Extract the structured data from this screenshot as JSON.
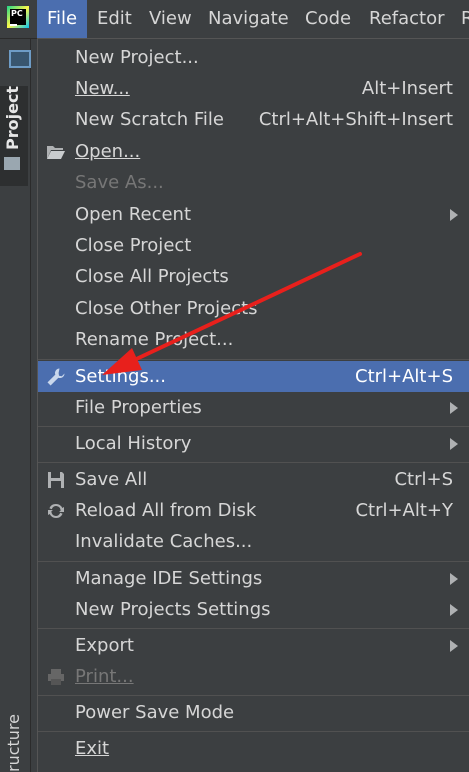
{
  "menubar": {
    "logo_text": "PC",
    "items": [
      "File",
      "Edit",
      "View",
      "Navigate",
      "Code",
      "Refactor",
      "R"
    ]
  },
  "sidebar": {
    "project_label": "Project",
    "structure_label": "ructure"
  },
  "file_menu": {
    "new_project": "New Project...",
    "new": "New...",
    "new_shortcut": "Alt+Insert",
    "new_scratch": "New Scratch File",
    "new_scratch_shortcut": "Ctrl+Alt+Shift+Insert",
    "open": "Open...",
    "save_as": "Save As...",
    "open_recent": "Open Recent",
    "close_project": "Close Project",
    "close_all_projects": "Close All Projects",
    "close_other_projects": "Close Other Projects",
    "rename_project": "Rename Project...",
    "settings": "Settings...",
    "settings_shortcut": "Ctrl+Alt+S",
    "file_properties": "File Properties",
    "local_history": "Local History",
    "save_all": "Save All",
    "save_all_shortcut": "Ctrl+S",
    "reload_all": "Reload All from Disk",
    "reload_all_shortcut": "Ctrl+Alt+Y",
    "invalidate_caches": "Invalidate Caches...",
    "manage_ide_settings": "Manage IDE Settings",
    "new_projects_settings": "New Projects Settings",
    "export": "Export",
    "print": "Print...",
    "power_save_mode": "Power Save Mode",
    "exit": "Exit"
  },
  "colors": {
    "highlight": "#4b6eaf",
    "menu_background": "#3c3f41",
    "annotation_arrow": "#e8201c"
  }
}
